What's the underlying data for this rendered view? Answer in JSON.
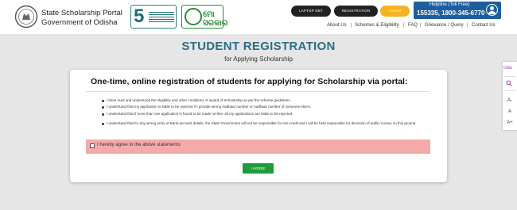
{
  "header": {
    "title": "State Scholarship Portal",
    "subtitle": "Government of Odisha",
    "logo_5t_number": "5",
    "logo_mo": "ମୋ ସରକାର",
    "buttons": {
      "laptop": "LAPTOP DBT",
      "registration": "REGISTRATION",
      "login": "LOGIN"
    },
    "helpline": {
      "label": "Helpline (Toll Free)",
      "numbers": "155335, 1800-345-6770"
    },
    "nav": [
      "About Us",
      "Schemes & Eligibility",
      "FAQ",
      "Grievance / Query",
      "Contact Us"
    ]
  },
  "page": {
    "title": "STUDENT REGISTRATION",
    "subtitle": "for Applying Scholarship"
  },
  "card": {
    "heading": "One-time, online registration of students for applying for Scholarship via portal:",
    "statements": [
      "I have read and understood the eligibility and other conditions of award of Scholarship as per the scheme guidelines.",
      "I understand that my application is liable to be rejected if I provide wrong Aadhaar number or Aadhaar number of someone else's.",
      "I understand that if more than one application is found to be made on-line, all my applications are liable to be rejected.",
      "I understand that for any wrong entry of Bank-account details, the State Government will not be responsible for mis-credit and I will be held responsible for diversion of public money on this ground."
    ],
    "agree_label": "I hereby agree to the above statements:",
    "agree_button": "I AGREE"
  },
  "side_tools": {
    "language": "Odia",
    "font_decrease": "A-",
    "font_normal": "A",
    "font_increase": "A+"
  },
  "colors": {
    "title": "#2a6e88",
    "helpline_bg": "#1d5f9e",
    "login_bg": "#f5b321",
    "agree_bar": "#f5aaaa",
    "agree_button": "#1e9c3a"
  }
}
